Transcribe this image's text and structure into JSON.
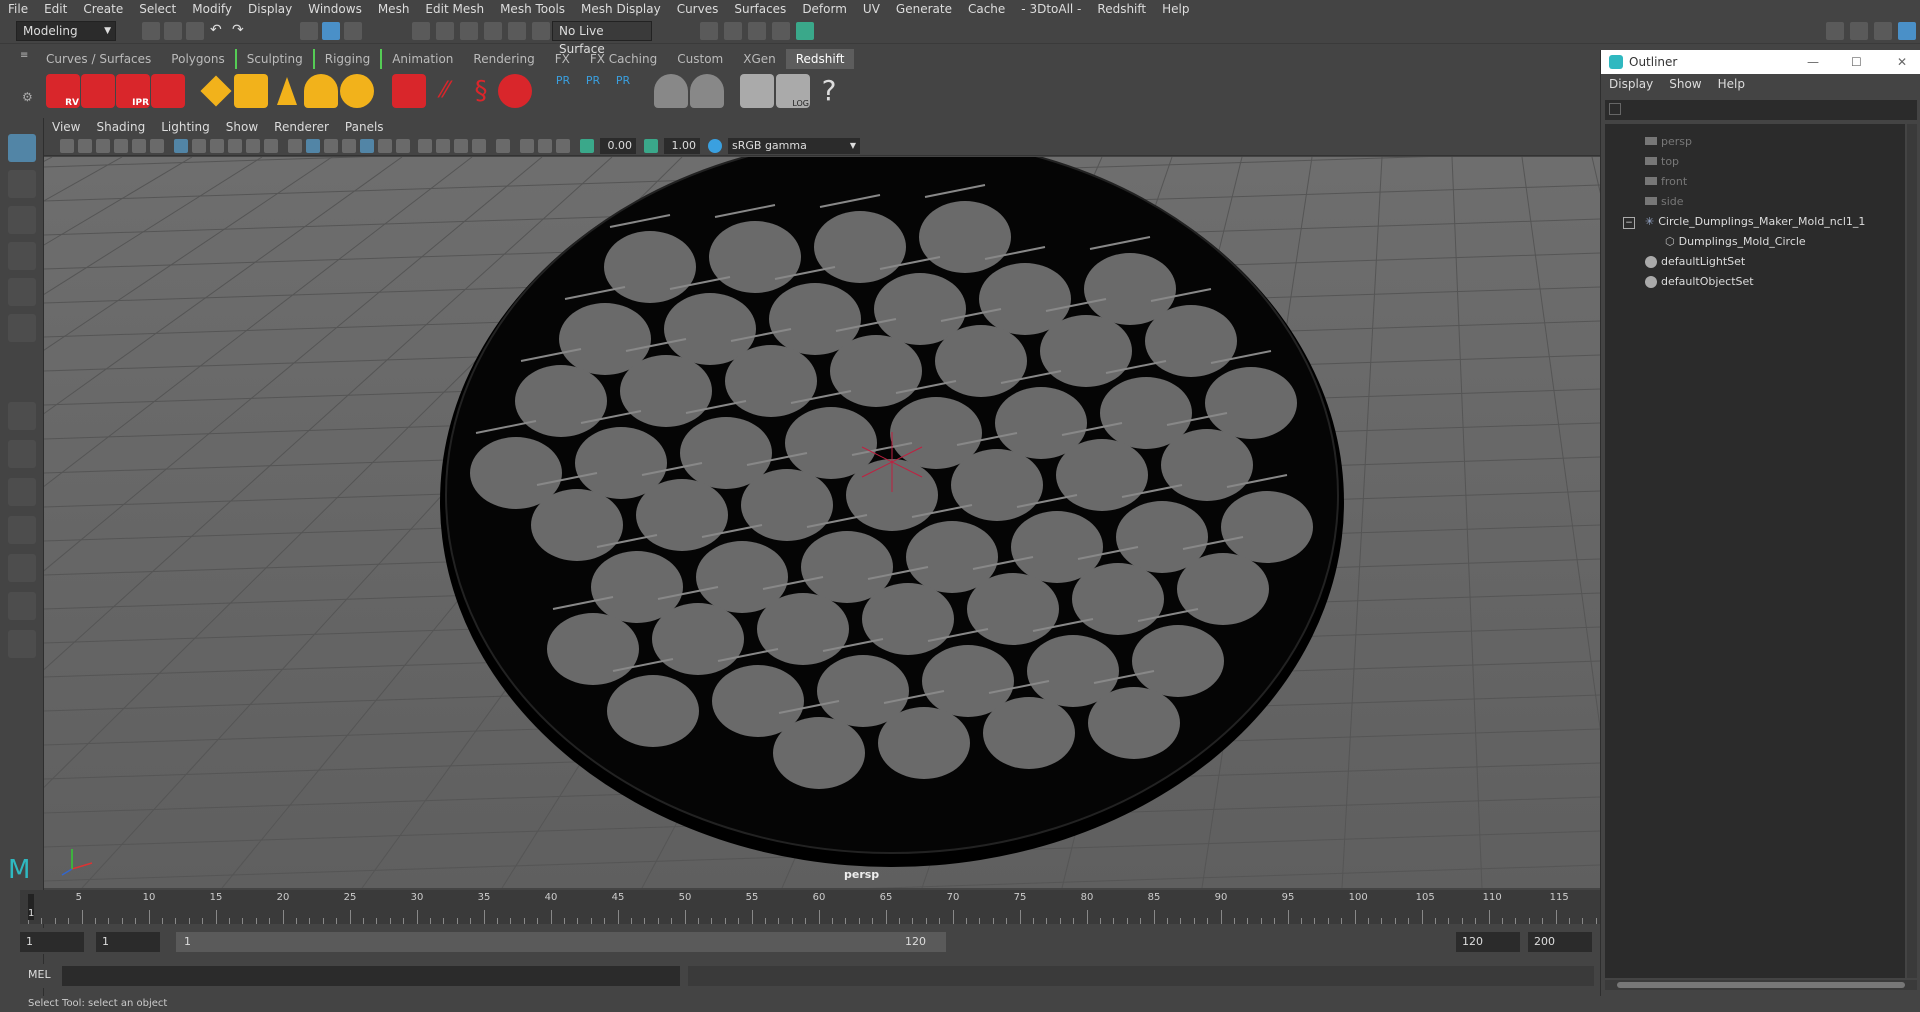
{
  "menubar": {
    "items": [
      "File",
      "Edit",
      "Create",
      "Select",
      "Modify",
      "Display",
      "Windows",
      "Mesh",
      "Edit Mesh",
      "Mesh Tools",
      "Mesh Display",
      "Curves",
      "Surfaces",
      "Deform",
      "UV",
      "Generate",
      "Cache",
      "- 3DtoAll -",
      "Redshift",
      "Help"
    ]
  },
  "status": {
    "workspace": "Modeling",
    "live_surface": "No Live Surface"
  },
  "shelf": {
    "tabs": [
      "Curves / Surfaces",
      "Polygons",
      "Sculpting",
      "Rigging",
      "Animation",
      "Rendering",
      "FX",
      "FX Caching",
      "Custom",
      "XGen",
      "Redshift"
    ],
    "active_tab": "Redshift",
    "icon_labels": {
      "rv": "RV",
      "ipr": "IPR",
      "pr1": "PR",
      "pr2": "PR",
      "pr3": "PR",
      "log": "LOG",
      "help": "?"
    }
  },
  "viewport": {
    "menu": [
      "View",
      "Shading",
      "Lighting",
      "Show",
      "Renderer",
      "Panels"
    ],
    "exposure": "0.00",
    "gamma": "1.00",
    "color_space": "sRGB gamma",
    "camera_label": "persp"
  },
  "timeline": {
    "ticks": [
      "5",
      "10",
      "15",
      "20",
      "25",
      "30",
      "35",
      "40",
      "45",
      "50",
      "55",
      "60",
      "65",
      "70",
      "75",
      "80",
      "85",
      "90",
      "95",
      "100",
      "105",
      "110",
      "115"
    ],
    "current_frame": "1"
  },
  "range": {
    "start": "1",
    "anim_start": "1",
    "slider_start": "1",
    "slider_end": "120",
    "end": "120",
    "anim_end": "200"
  },
  "mel": {
    "label": "MEL"
  },
  "helpline": "Select Tool: select an object",
  "outliner": {
    "title": "Outliner",
    "menu": [
      "Display",
      "Show",
      "Help"
    ],
    "items": [
      {
        "label": "persp",
        "type": "camera"
      },
      {
        "label": "top",
        "type": "camera"
      },
      {
        "label": "front",
        "type": "camera"
      },
      {
        "label": "side",
        "type": "camera"
      },
      {
        "label": "Circle_Dumplings_Maker_Mold_ncl1_1",
        "type": "group"
      },
      {
        "label": "Dumplings_Mold_Circle",
        "type": "mesh"
      },
      {
        "label": "defaultLightSet",
        "type": "set"
      },
      {
        "label": "defaultObjectSet",
        "type": "set"
      }
    ]
  },
  "colors": {
    "ui_bg": "#444444",
    "viewport_bg": "#6a6a6a",
    "redshift_red": "#d9262b",
    "accent_yellow": "#f2b21b",
    "pr_blue": "#3aa0e0"
  }
}
